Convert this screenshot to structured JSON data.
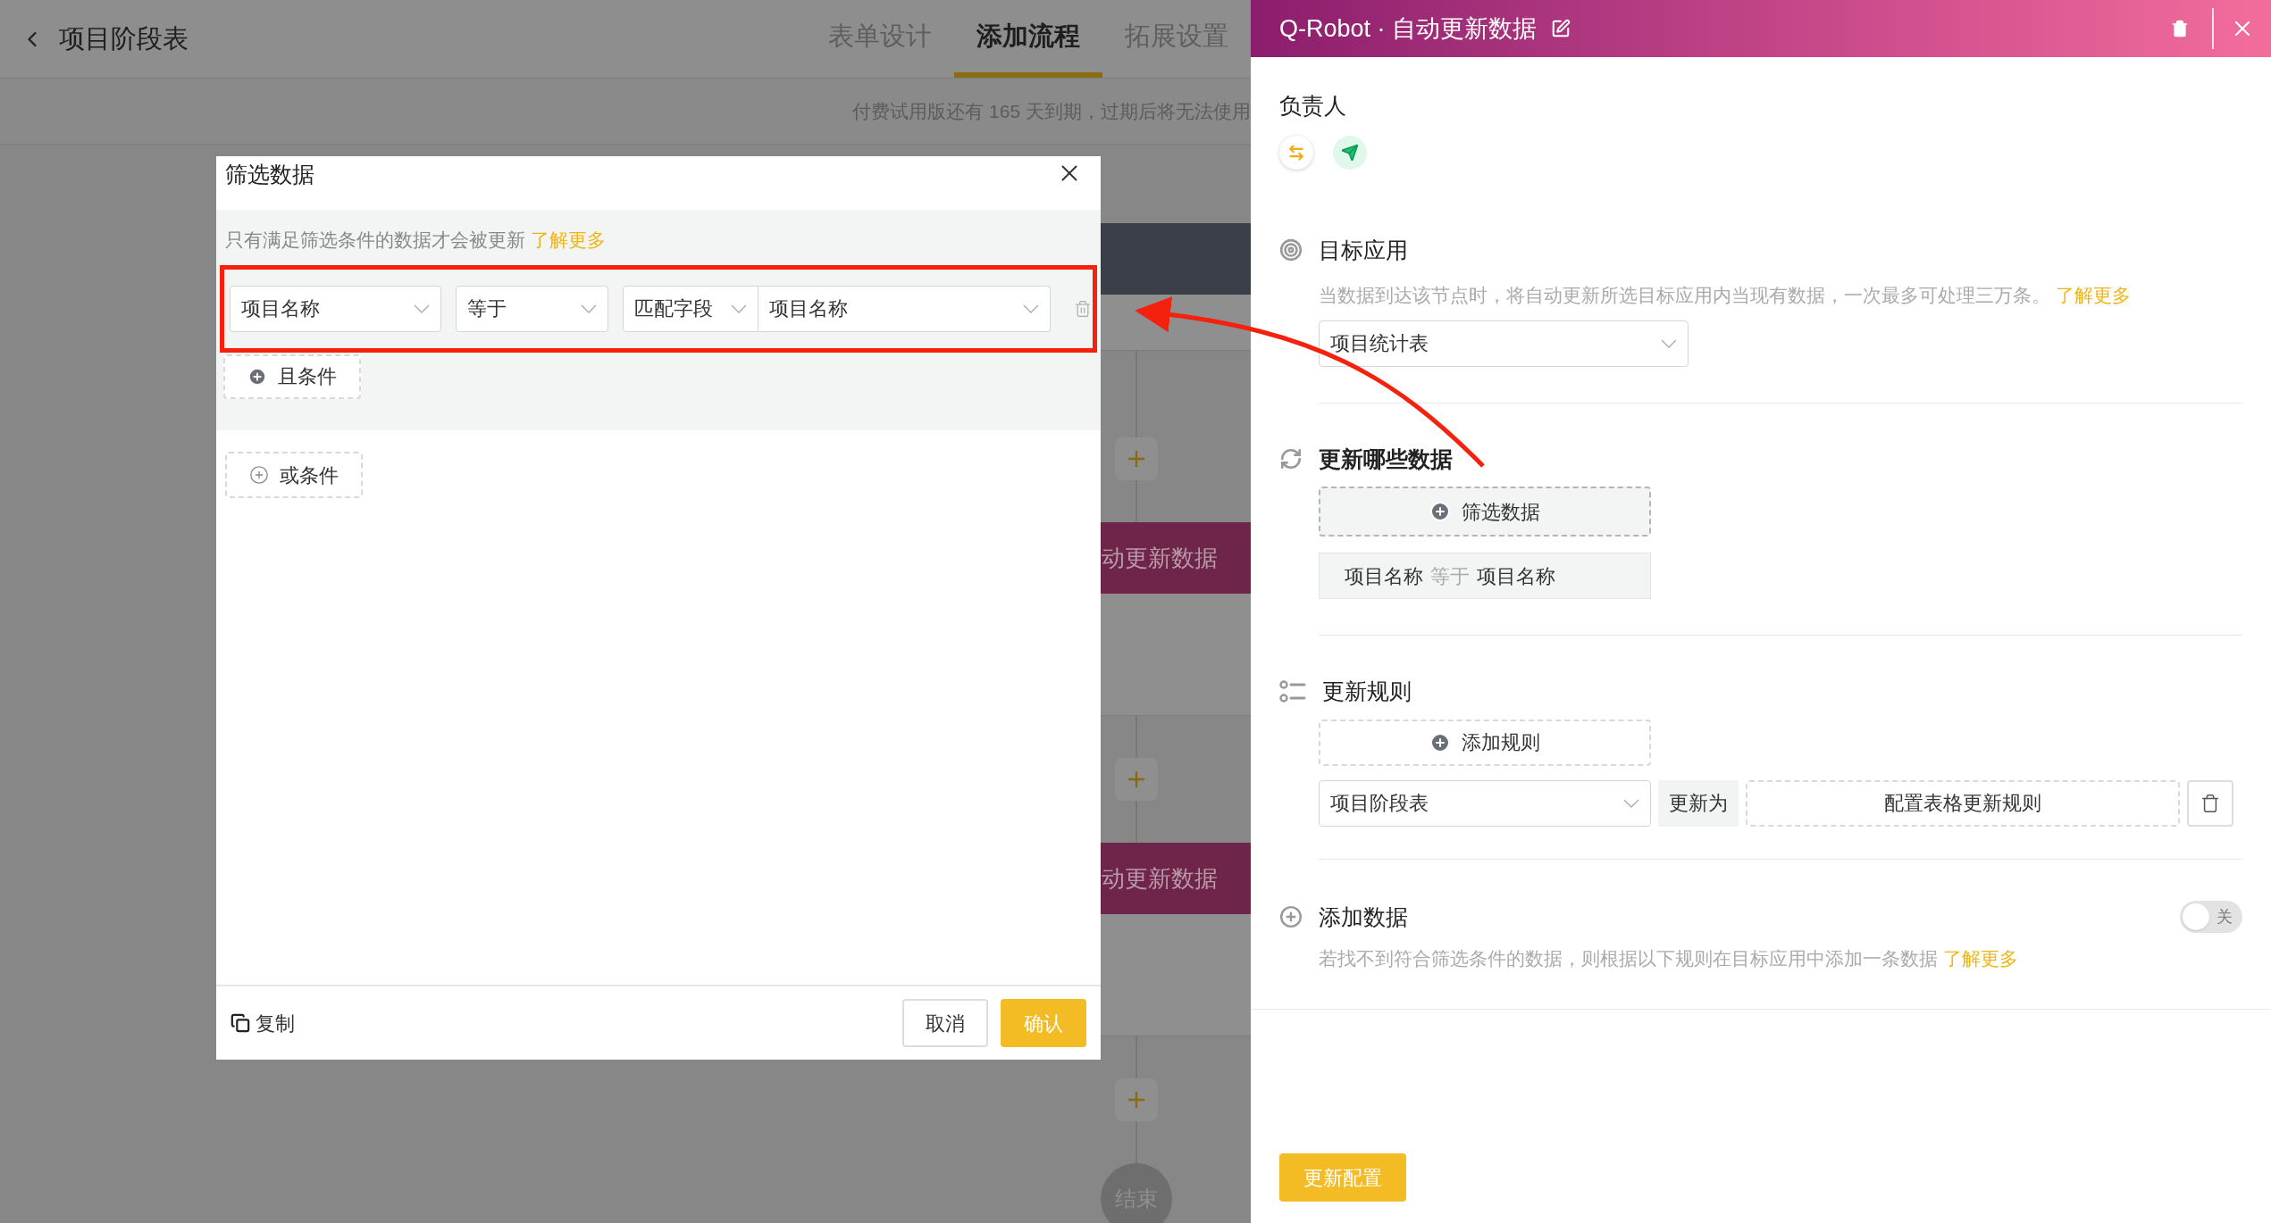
{
  "header": {
    "title": "项目阶段表",
    "tabs": [
      {
        "label": "表单设计",
        "selected": false
      },
      {
        "label": "添加流程",
        "selected": true
      },
      {
        "label": "拓展设置",
        "selected": false
      }
    ]
  },
  "notice": "付费试用版还有 165 天到期，过期后将无法使用",
  "flow": {
    "nodes": [
      {
        "kind": "header"
      },
      {
        "kind": "add"
      },
      {
        "kind": "action",
        "label": "动更新数据"
      },
      {
        "kind": "add"
      },
      {
        "kind": "action",
        "label": "动更新数据"
      },
      {
        "kind": "add"
      },
      {
        "kind": "end",
        "label": "结束"
      }
    ]
  },
  "modal": {
    "title": "筛选数据",
    "hint": "只有满足筛选条件的数据才会被更新",
    "hint_link": "了解更多",
    "conditions": [
      {
        "field": "项目名称",
        "operator": "等于",
        "match_type": "匹配字段",
        "value": "项目名称"
      }
    ],
    "and_button": "且条件",
    "or_button": "或条件",
    "copy": "复制",
    "cancel": "取消",
    "confirm": "确认"
  },
  "drawer": {
    "title": "Q-Robot · 自动更新数据",
    "owner": {
      "label": "负责人"
    },
    "target_app": {
      "title": "目标应用",
      "description": "当数据到达该节点时，将自动更新所选目标应用内当现有数据，一次最多可处理三万条。",
      "link": "了解更多",
      "value": "项目统计表"
    },
    "update_scope": {
      "title": "更新哪些数据",
      "filter_button": "筛选数据",
      "summary": {
        "field": "项目名称",
        "operator": "等于",
        "value": "项目名称"
      }
    },
    "update_rules": {
      "title": "更新规则",
      "add_button": "添加规则",
      "rules": [
        {
          "field": "项目阶段表",
          "connector": "更新为",
          "action": "配置表格更新规则"
        }
      ]
    },
    "add_data": {
      "title": "添加数据",
      "toggle": {
        "label": "关",
        "on": false
      },
      "description": "若找不到符合筛选条件的数据，则根据以下规则在目标应用中添加一条数据",
      "link": "了解更多"
    },
    "save_button": "更新配置"
  }
}
